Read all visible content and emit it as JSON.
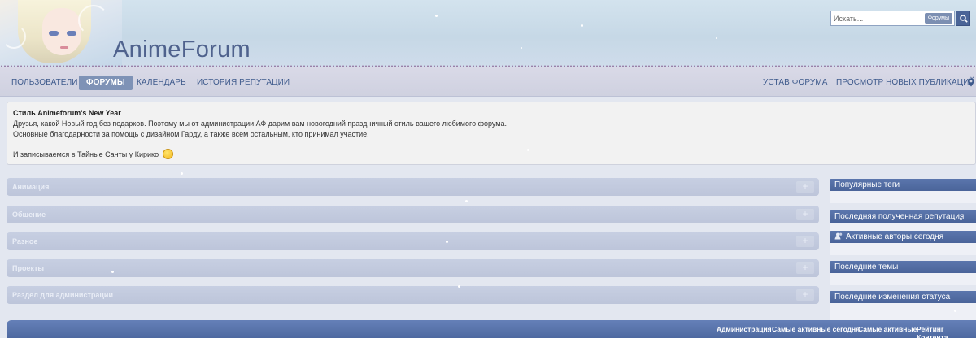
{
  "header": {
    "site_title": "AnimeForum",
    "search": {
      "placeholder": "Искать...",
      "scope_label": "Форумы"
    }
  },
  "nav": {
    "left": [
      "ПОЛЬЗОВАТЕЛИ",
      "ФОРУМЫ",
      "КАЛЕНДАРЬ",
      "ИСТОРИЯ РЕПУТАЦИИ"
    ],
    "active": "ФОРУМЫ",
    "right": [
      "УСТАВ ФОРУМА",
      "ПРОСМОТР НОВЫХ ПУБЛИКАЦИЙ"
    ]
  },
  "notice": {
    "title": "Стиль Animeforum's New Year",
    "lines": [
      "Друзья, какой Новый год без подарков. Поэтому мы от администрации АФ дарим вам новогодний праздничный стиль вашего любимого форума.",
      "Основные благодарности за помощь с дизайном Гарду, а также всем остальным, кто принимал участие.",
      "И записываемся в Тайные Санты у Кирико"
    ]
  },
  "categories": [
    "Анимация",
    "Общение",
    "Разное",
    "Проекты",
    "Раздел для администрации"
  ],
  "sidebar": [
    "Популярные теги",
    "Последняя полученная репутация",
    "Активные авторы сегодня",
    "Последние темы",
    "Последние изменения статуса"
  ],
  "footer_links": [
    "Администрация",
    "Самые активные сегодня",
    "Самые активные",
    "Рейтинг Контента"
  ],
  "icons": {
    "search": "search-icon",
    "location": "map-pin-icon",
    "users": "users-icon",
    "smiley": "smiley-icon",
    "expand": "plus-icon"
  },
  "colors": {
    "nav_active": "#7e92b6",
    "sidebar_header": "#4a6499",
    "title": "#4f628d",
    "footer": "#4e69a0"
  }
}
